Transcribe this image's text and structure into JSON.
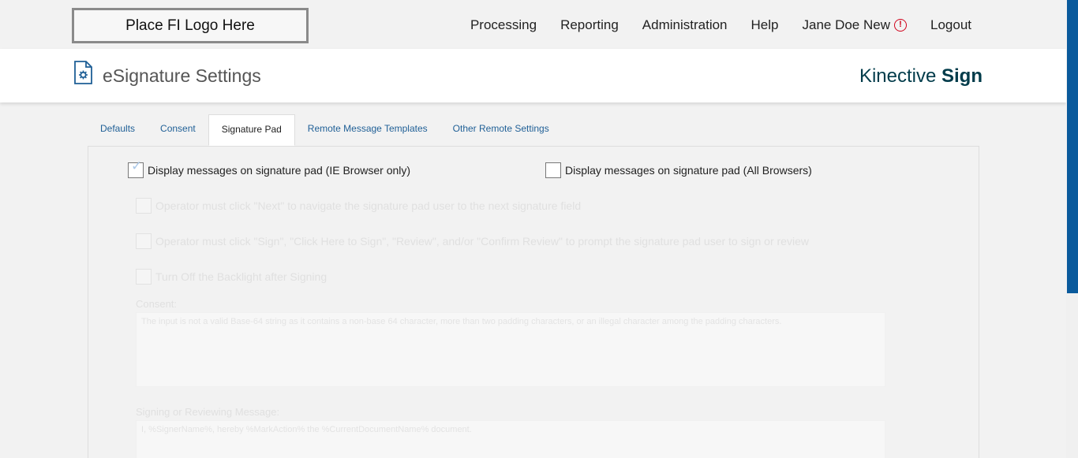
{
  "logo": {
    "text": "Place FI Logo Here"
  },
  "nav": {
    "processing": "Processing",
    "reporting": "Reporting",
    "administration": "Administration",
    "help": "Help",
    "user": "Jane Doe New",
    "alert_symbol": "!",
    "logout": "Logout"
  },
  "header": {
    "title": "eSignature Settings",
    "brand_light": "Kinective",
    "brand_bold": "Sign"
  },
  "tabs": [
    "Defaults",
    "Consent",
    "Signature Pad",
    "Remote Message Templates",
    "Other Remote Settings"
  ],
  "settings": {
    "ie_only": {
      "label": "Display messages on signature pad (IE Browser only)",
      "checked": true
    },
    "all_browsers": {
      "label": "Display messages on signature pad (All Browsers)",
      "checked": false
    },
    "next_field": "Operator must click \"Next\" to navigate the signature pad user to the next signature field",
    "sign_prompt": "Operator must click \"Sign\", \"Click Here to Sign\", \"Review\", and/or \"Confirm Review\" to prompt the signature pad user to sign or review",
    "backlight": "Turn Off the Backlight after Signing",
    "consent_label": "Consent:",
    "consent_text": "The input is not a valid Base-64 string as it contains a non-base 64 character, more than two padding characters, or an illegal character among the padding characters.",
    "signing_label": "Signing or Reviewing Message:",
    "signing_text": "I, %SignerName%, hereby %MarkAction% the %CurrentDocumentName% document."
  }
}
